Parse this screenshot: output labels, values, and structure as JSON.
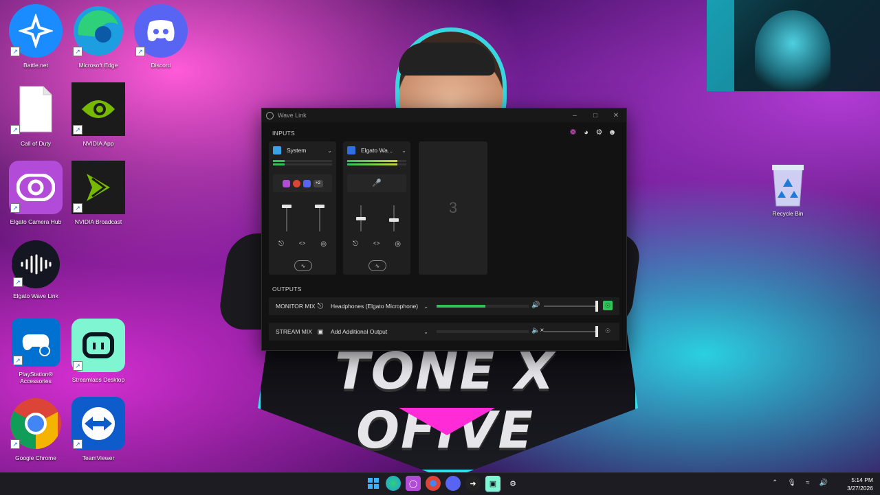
{
  "desktop": {
    "icons": [
      {
        "label": "Battle.net",
        "color": "#1a8cff"
      },
      {
        "label": "Microsoft Edge",
        "color": "#21a36b"
      },
      {
        "label": "Discord",
        "color": "#5865f2"
      },
      {
        "label": "Call of Duty",
        "color": "#ffffff"
      },
      {
        "label": "NVIDIA App",
        "color": "#76b900"
      },
      {
        "label": "Elgato Camera Hub",
        "color": "#b14bd8"
      },
      {
        "label": "NVIDIA Broadcast",
        "color": "#76b900"
      },
      {
        "label": "Elgato Wave Link",
        "color": "#141622"
      },
      {
        "label": "PlayStation® Accessories",
        "color": "#0070d1"
      },
      {
        "label": "Streamlabs Desktop",
        "color": "#80f5d2"
      },
      {
        "label": "Google Chrome",
        "color": "#ffffff"
      },
      {
        "label": "TeamViewer",
        "color": "#0e5ccc"
      }
    ],
    "recycle_bin_label": "Recycle Bin"
  },
  "wallpaper": {
    "logo_text": "TONE X OFIVE"
  },
  "wavelink": {
    "title": "Wave Link",
    "inputs_label": "INPUTS",
    "outputs_label": "OUTPUTS",
    "inputs": [
      {
        "name": "System",
        "icon": "monitor-icon",
        "icon_color": "#3aa3e8",
        "meter_level": 0.2,
        "meter_color": "#2ec45a"
      },
      {
        "name": "Elgato Wa...",
        "icon": "microphone-icon",
        "icon_color": "#2f6fe0",
        "meter_level": 0.85,
        "meter_color": "#c8d43a"
      }
    ],
    "system_apps_more": "+2",
    "empty_slot_number": "3",
    "outputs": [
      {
        "mix": "MONITOR MIX",
        "device": "Headphones (Elgato Microphone)",
        "level": 0.53,
        "muted": false
      },
      {
        "mix": "STREAM MIX",
        "device": "Add Additional Output",
        "level": 0.0,
        "muted": true
      }
    ]
  },
  "taskbar": {
    "time": "5:14 PM",
    "date": "3/27/2026"
  }
}
